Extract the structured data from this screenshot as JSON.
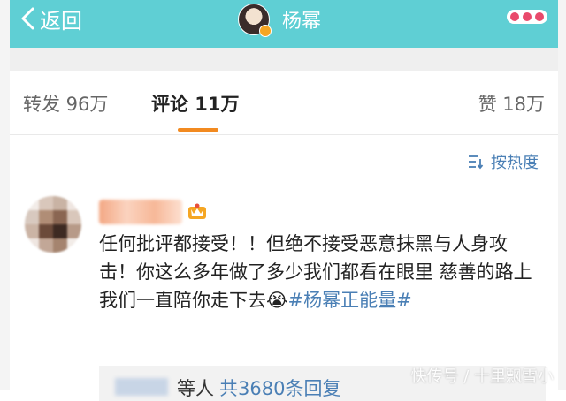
{
  "navbar": {
    "back_label": "返回",
    "title": "杨幂",
    "accent_color": "#5fcfd4"
  },
  "tabs": {
    "repost": "转发 96万",
    "comment": "评论 11万",
    "like": "赞 18万",
    "active": "comment"
  },
  "sort": {
    "label": "按热度",
    "icon": "sort-icon"
  },
  "comment": {
    "text_main": "任何批评都接受！！但绝不接受恶意抹黑与人身攻击！你这么多年做了多少我们都看在眼里 慈善的路上我们一直陪你走下去😭",
    "hashtag": "#杨幂正能量#",
    "badge_icon": "crown-icon"
  },
  "reply": {
    "prefix": "等人",
    "count": "共3680条回复"
  },
  "watermark": "快传号 / 十里飘雪小"
}
